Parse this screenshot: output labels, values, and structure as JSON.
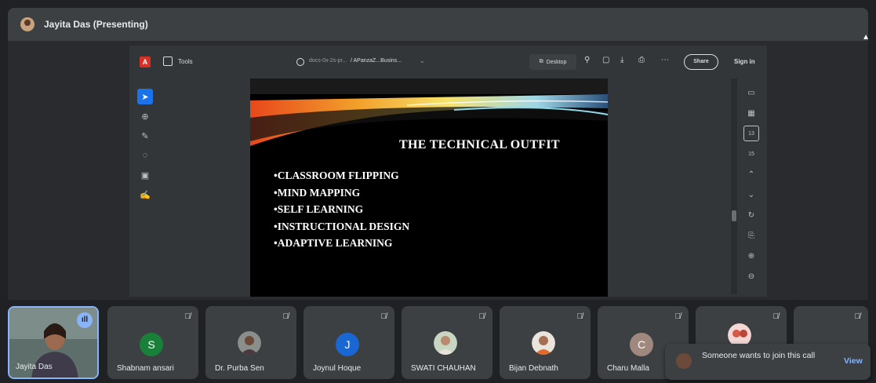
{
  "presenter": {
    "name": "Jayita Das (Presenting)"
  },
  "viewer": {
    "tools_label": "Tools",
    "url": "docs-0x-2s-pr...",
    "filename": "/ APanzaZ...Busins...",
    "desktop_label": "Desktop",
    "share_label": "Share",
    "signin_label": "Sign in",
    "page_badge": "13",
    "page_next": "15"
  },
  "slide": {
    "title": "THE TECHNICAL OUTFIT",
    "bullets": [
      "•CLASSROOM FLIPPING",
      "•MIND MAPPING",
      "•SELF LEARNING",
      "•INSTRUCTIONAL DESIGN",
      "•ADAPTIVE LEARNING"
    ]
  },
  "participants": [
    {
      "name": "Jayita Das",
      "type": "photo",
      "self": true
    },
    {
      "name": "Shabnam ansari",
      "initial": "S",
      "color": "#188038"
    },
    {
      "name": "Dr. Purba Sen",
      "type": "photo"
    },
    {
      "name": "Joynul Hoque",
      "initial": "J",
      "color": "#1967d2"
    },
    {
      "name": "SWATI CHAUHAN",
      "type": "photo"
    },
    {
      "name": "Bijan Debnath",
      "type": "photo"
    },
    {
      "name": "Charu Malla",
      "initial": "C",
      "color": "#a1887f"
    }
  ],
  "toast": {
    "message": "Someone wants to join this call",
    "action": "View"
  },
  "colors": {
    "accent": "#8ab4f8",
    "pdf_red": "#d93025",
    "tool_active": "#1a73e8"
  }
}
